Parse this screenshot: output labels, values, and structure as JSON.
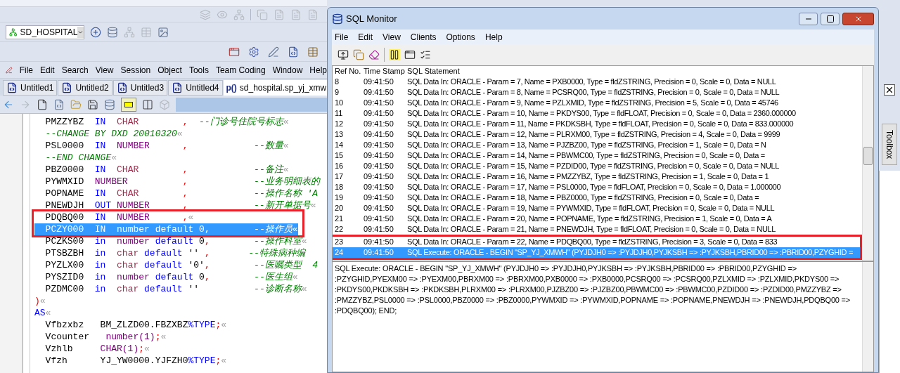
{
  "ide": {
    "connection": "SD_HOSPITAL",
    "menu": [
      "File",
      "Edit",
      "Search",
      "View",
      "Session",
      "Object",
      "Tools",
      "Team Coding",
      "Window",
      "Help"
    ],
    "tabs": [
      {
        "label": "Untitled1",
        "selected": false
      },
      {
        "label": "Untitled2",
        "selected": false
      },
      {
        "label": "Untitled3",
        "selected": false
      },
      {
        "label": "Untitled4",
        "selected": false
      },
      {
        "prefix": "p()",
        "label": "sd_hospital.sp_yj_xmw",
        "selected": true
      }
    ],
    "code_lines": [
      {
        "selected": false,
        "tokens": [
          {
            "kind": "id",
            "text": "  PMZZYBZ"
          },
          {
            "kind": "kw",
            "text": "  IN"
          },
          {
            "kind": "ct",
            "text": "  CHAR"
          },
          {
            "kind": "pu",
            "text": "        ,"
          },
          {
            "kind": "cm",
            "text": "  --门诊号住院号标志"
          },
          {
            "kind": "eol",
            "text": "«"
          }
        ]
      },
      {
        "selected": false,
        "tokens": [
          {
            "kind": "cm",
            "text": "  --CHANGE BY DXD 20010320"
          },
          {
            "kind": "eol",
            "text": "«"
          }
        ]
      },
      {
        "selected": false,
        "tokens": [
          {
            "kind": "id",
            "text": "  PSL0000"
          },
          {
            "kind": "kw",
            "text": "  IN"
          },
          {
            "kind": "ty",
            "text": "  NUMBER"
          },
          {
            "kind": "pu",
            "text": "      ,"
          },
          {
            "kind": "cm",
            "text": "            --数量"
          },
          {
            "kind": "eol",
            "text": "«"
          }
        ]
      },
      {
        "selected": false,
        "tokens": [
          {
            "kind": "cm",
            "text": "  --END CHANGE"
          },
          {
            "kind": "eol",
            "text": "«"
          }
        ]
      },
      {
        "selected": false,
        "tokens": [
          {
            "kind": "id",
            "text": "  PBZ0000"
          },
          {
            "kind": "kw",
            "text": "  IN"
          },
          {
            "kind": "ct",
            "text": "  CHAR"
          },
          {
            "kind": "pu",
            "text": "        ,"
          },
          {
            "kind": "cm",
            "text": "            --备注"
          },
          {
            "kind": "eol",
            "text": "«"
          }
        ]
      },
      {
        "selected": false,
        "tokens": [
          {
            "kind": "id",
            "text": "  PYWMXID"
          },
          {
            "kind": "ty",
            "text": "  NUMBER"
          },
          {
            "kind": "pu",
            "text": "          ,"
          },
          {
            "kind": "cm",
            "text": "            --业务明细表的"
          }
        ]
      },
      {
        "selected": false,
        "tokens": [
          {
            "kind": "id",
            "text": "  POPNAME"
          },
          {
            "kind": "kw",
            "text": "  IN"
          },
          {
            "kind": "ct",
            "text": "  CHAR"
          },
          {
            "kind": "pu",
            "text": "        ,"
          },
          {
            "kind": "cm",
            "text": "            --操作名称 'A"
          }
        ]
      },
      {
        "selected": false,
        "tokens": [
          {
            "kind": "id",
            "text": "  PNEWDJH"
          },
          {
            "kind": "kw",
            "text": "  OUT"
          },
          {
            "kind": "ty",
            "text": " NUMBER"
          },
          {
            "kind": "pu",
            "text": "      ,"
          },
          {
            "kind": "cm",
            "text": "            --新开单据号"
          },
          {
            "kind": "eol",
            "text": "«"
          }
        ]
      },
      {
        "selected": false,
        "boxed": true,
        "tokens": [
          {
            "kind": "id",
            "text": "  PDQBQ00"
          },
          {
            "kind": "kw",
            "text": "  IN"
          },
          {
            "kind": "ty",
            "text": "  NUMBER"
          },
          {
            "kind": "pu",
            "text": "      ,"
          },
          {
            "kind": "eol",
            "text": "«"
          }
        ]
      },
      {
        "selected": true,
        "boxed": true,
        "tokens": [
          {
            "kind": "id",
            "text": "  PCZY000"
          },
          {
            "kind": "kw",
            "text": "  IN"
          },
          {
            "kind": "ty",
            "text": "  number"
          },
          {
            "kind": "kw",
            "text": " default"
          },
          {
            "kind": "id",
            "text": " 0"
          },
          {
            "kind": "pu",
            "text": ","
          },
          {
            "kind": "cm",
            "text": "        --操作员"
          },
          {
            "kind": "eol",
            "text": "«"
          }
        ]
      },
      {
        "selected": false,
        "tokens": [
          {
            "kind": "id",
            "text": "  PCZKS00"
          },
          {
            "kind": "kw",
            "text": "  in"
          },
          {
            "kind": "ty",
            "text": "  number"
          },
          {
            "kind": "kw",
            "text": " default"
          },
          {
            "kind": "id",
            "text": " 0"
          },
          {
            "kind": "pu",
            "text": ","
          },
          {
            "kind": "cm",
            "text": "        --操作科室"
          },
          {
            "kind": "eol",
            "text": "«"
          }
        ]
      },
      {
        "selected": false,
        "tokens": [
          {
            "kind": "id",
            "text": "  PTSBZBH"
          },
          {
            "kind": "kw",
            "text": "  in"
          },
          {
            "kind": "ct",
            "text": "  char"
          },
          {
            "kind": "kw",
            "text": " default"
          },
          {
            "kind": "id",
            "text": " ''"
          },
          {
            "kind": "pu",
            "text": " ,"
          },
          {
            "kind": "cm",
            "text": "       --特殊病种编"
          }
        ]
      },
      {
        "selected": false,
        "tokens": [
          {
            "kind": "id",
            "text": "  PYZLX00"
          },
          {
            "kind": "kw",
            "text": "  in"
          },
          {
            "kind": "ct",
            "text": "  char"
          },
          {
            "kind": "kw",
            "text": " default"
          },
          {
            "kind": "id",
            "text": " '0'"
          },
          {
            "kind": "pu",
            "text": ","
          },
          {
            "kind": "cm",
            "text": "        --医嘱类型  4"
          }
        ]
      },
      {
        "selected": false,
        "tokens": [
          {
            "kind": "id",
            "text": "  PYSZID0"
          },
          {
            "kind": "kw",
            "text": "  in"
          },
          {
            "kind": "ty",
            "text": "  number"
          },
          {
            "kind": "kw",
            "text": " default"
          },
          {
            "kind": "id",
            "text": " 0"
          },
          {
            "kind": "pu",
            "text": ","
          },
          {
            "kind": "cm",
            "text": "        --医生组"
          },
          {
            "kind": "eol",
            "text": "«"
          }
        ]
      },
      {
        "selected": false,
        "tokens": [
          {
            "kind": "id",
            "text": "  PZDMC00"
          },
          {
            "kind": "kw",
            "text": "  in"
          },
          {
            "kind": "ct",
            "text": "  char"
          },
          {
            "kind": "kw",
            "text": " default"
          },
          {
            "kind": "id",
            "text": " ''"
          },
          {
            "kind": "cm",
            "text": "          --诊断名称"
          },
          {
            "kind": "eol",
            "text": "«"
          }
        ]
      },
      {
        "selected": false,
        "tokens": [
          {
            "kind": "pu",
            "text": ")"
          },
          {
            "kind": "eol",
            "text": "«"
          }
        ]
      },
      {
        "selected": false,
        "tokens": [
          {
            "kind": "kw",
            "text": "AS"
          },
          {
            "kind": "eol",
            "text": "«"
          }
        ]
      },
      {
        "selected": false,
        "tokens": [
          {
            "kind": "id",
            "text": "  Vfbzxbz   BM_ZLZD00.FBZXBZ"
          },
          {
            "kind": "kw",
            "text": "%TYPE"
          },
          {
            "kind": "pu",
            "text": ";"
          },
          {
            "kind": "eol",
            "text": "«"
          }
        ]
      },
      {
        "selected": false,
        "tokens": [
          {
            "kind": "id",
            "text": "  Vcounter"
          },
          {
            "kind": "ty",
            "text": "   number(1)"
          },
          {
            "kind": "pu",
            "text": ";"
          },
          {
            "kind": "eol",
            "text": "«"
          }
        ]
      },
      {
        "selected": false,
        "tokens": [
          {
            "kind": "id",
            "text": "  Vzhlb"
          },
          {
            "kind": "ty",
            "text": "     CHAR(1)"
          },
          {
            "kind": "pu",
            "text": ";"
          },
          {
            "kind": "eol",
            "text": "«"
          }
        ]
      },
      {
        "selected": false,
        "tokens": [
          {
            "kind": "id",
            "text": "  Vfzh      YJ_YW0000.YJFZH0"
          },
          {
            "kind": "kw",
            "text": "%TYPE"
          },
          {
            "kind": "pu",
            "text": ";"
          },
          {
            "kind": "eol",
            "text": "«"
          }
        ]
      }
    ]
  },
  "monitor": {
    "title": "SQL Monitor",
    "menu": [
      "File",
      "Edit",
      "View",
      "Clients",
      "Options",
      "Help"
    ],
    "columns": [
      "Ref No.",
      "Time Stamp",
      "SQL Statement"
    ],
    "rows": [
      {
        "ref": "8",
        "time": "09:41:50",
        "statement": "SQL Data In: ORACLE - Param = 7, Name = PXB0000, Type = fldZSTRING, Precision = 0, Scale = 0, Data = NULL",
        "selected": false
      },
      {
        "ref": "9",
        "time": "09:41:50",
        "statement": "SQL Data In: ORACLE - Param = 8, Name = PCSRQ00, Type = fldZSTRING, Precision = 0, Scale = 0, Data = NULL",
        "selected": false
      },
      {
        "ref": "10",
        "time": "09:41:50",
        "statement": "SQL Data In: ORACLE - Param = 9, Name = PZLXMID, Type = fldZSTRING, Precision = 5, Scale = 0, Data = 45746",
        "selected": false
      },
      {
        "ref": "11",
        "time": "09:41:50",
        "statement": "SQL Data In: ORACLE - Param = 10, Name = PKDYS00, Type = fldFLOAT, Precision = 0, Scale = 0, Data = 2360.000000",
        "selected": false
      },
      {
        "ref": "12",
        "time": "09:41:50",
        "statement": "SQL Data In: ORACLE - Param = 11, Name = PKDKSBH, Type = fldFLOAT, Precision = 0, Scale = 0, Data = 833.000000",
        "selected": false
      },
      {
        "ref": "13",
        "time": "09:41:50",
        "statement": "SQL Data In: ORACLE - Param = 12, Name = PLRXM00, Type = fldZSTRING, Precision = 4, Scale = 0, Data = 9999",
        "selected": false
      },
      {
        "ref": "14",
        "time": "09:41:50",
        "statement": "SQL Data In: ORACLE - Param = 13, Name = PJZBZ00, Type = fldZSTRING, Precision = 1, Scale = 0, Data = N",
        "selected": false
      },
      {
        "ref": "15",
        "time": "09:41:50",
        "statement": "SQL Data In: ORACLE - Param = 14, Name = PBWMC00, Type = fldZSTRING, Precision = 0, Scale = 0, Data =",
        "selected": false
      },
      {
        "ref": "16",
        "time": "09:41:50",
        "statement": "SQL Data In: ORACLE - Param = 15, Name = PZDID00, Type = fldZSTRING, Precision = 0, Scale = 0, Data = NULL",
        "selected": false
      },
      {
        "ref": "17",
        "time": "09:41:50",
        "statement": "SQL Data In: ORACLE - Param = 16, Name = PMZZYBZ, Type = fldZSTRING, Precision = 1, Scale = 0, Data = 1",
        "selected": false
      },
      {
        "ref": "18",
        "time": "09:41:50",
        "statement": "SQL Data In: ORACLE - Param = 17, Name = PSL0000, Type = fldFLOAT, Precision = 0, Scale = 0, Data = 1.000000",
        "selected": false
      },
      {
        "ref": "19",
        "time": "09:41:50",
        "statement": "SQL Data In: ORACLE - Param = 18, Name = PBZ0000, Type = fldZSTRING, Precision = 0, Scale = 0, Data =",
        "selected": false
      },
      {
        "ref": "20",
        "time": "09:41:50",
        "statement": "SQL Data In: ORACLE - Param = 19, Name = PYWMXID, Type = fldFLOAT, Precision = 0, Scale = 0, Data = NULL",
        "selected": false
      },
      {
        "ref": "21",
        "time": "09:41:50",
        "statement": "SQL Data In: ORACLE - Param = 20, Name = POPNAME, Type = fldZSTRING, Precision = 1, Scale = 0, Data = A",
        "selected": false
      },
      {
        "ref": "22",
        "time": "09:41:50",
        "statement": "SQL Data In: ORACLE - Param = 21, Name = PNEWDJH, Type = fldFLOAT, Precision = 0, Scale = 0, Data = NULL",
        "selected": false
      },
      {
        "ref": "23",
        "time": "09:41:50",
        "statement": "SQL Data In: ORACLE - Param = 22, Name = PDQBQ00, Type = fldZSTRING, Precision = 3, Scale = 0, Data = 833",
        "selected": false,
        "boxed": true
      },
      {
        "ref": "24",
        "time": "09:41:50",
        "statement": "SQL Execute: ORACLE - BEGIN \"SP_YJ_XMWH\" (PYJDJH0 => :PYJDJH0,PYJKSBH => :PYJKSBH,PBRID00 => :PBRID00,PZYGHID =",
        "selected": true,
        "boxed": true
      }
    ],
    "detail": "SQL Execute: ORACLE - BEGIN \"SP_YJ_XMWH\" (PYJDJH0 => :PYJDJH0,PYJKSBH => :PYJKSBH,PBRID00 => :PBRID00,PZYGHID => :PZYGHID,PYEXM00 => :PYEXM00,PBRXM00 => :PBRXM00,PXB0000 => :PXB0000,PCSRQ00 => :PCSRQ00,PZLXMID => :PZLXMID,PKDYS00 => :PKDYS00,PKDKSBH => :PKDKSBH,PLRXM00 => :PLRXM00,PJZBZ00 => :PJZBZ00,PBWMC00 => :PBWMC00,PZDID00 => :PZDID00,PMZZYBZ => :PMZZYBZ,PSL0000 => :PSL0000,PBZ0000 => :PBZ0000,PYWMXID => :PYWMXID,POPNAME => :POPNAME,PNEWDJH => :PNEWDJH,PDQBQ00 => :PDQBQ00); END;"
  },
  "toolbox": {
    "label": "Toolbox"
  }
}
